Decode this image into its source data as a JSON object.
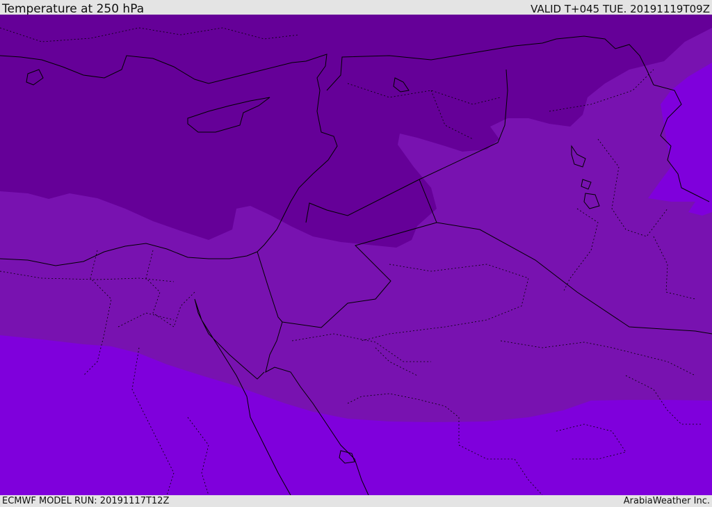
{
  "header": {
    "title": "Temperature at 250 hPa",
    "valid_time": "VALID T+045 TUE. 20191119T09Z"
  },
  "footer": {
    "model_run": "ECMWF MODEL RUN: 20191117T12Z",
    "credit": "ArabiaWeather Inc."
  },
  "map": {
    "field": "temperature",
    "level": "250 hPa",
    "region": "Eastern Mediterranean / Middle East",
    "colors": {
      "coldest": "#650098",
      "middle": "#7812b0",
      "warmest": "#7f00dc",
      "border_line": "#000000"
    }
  }
}
